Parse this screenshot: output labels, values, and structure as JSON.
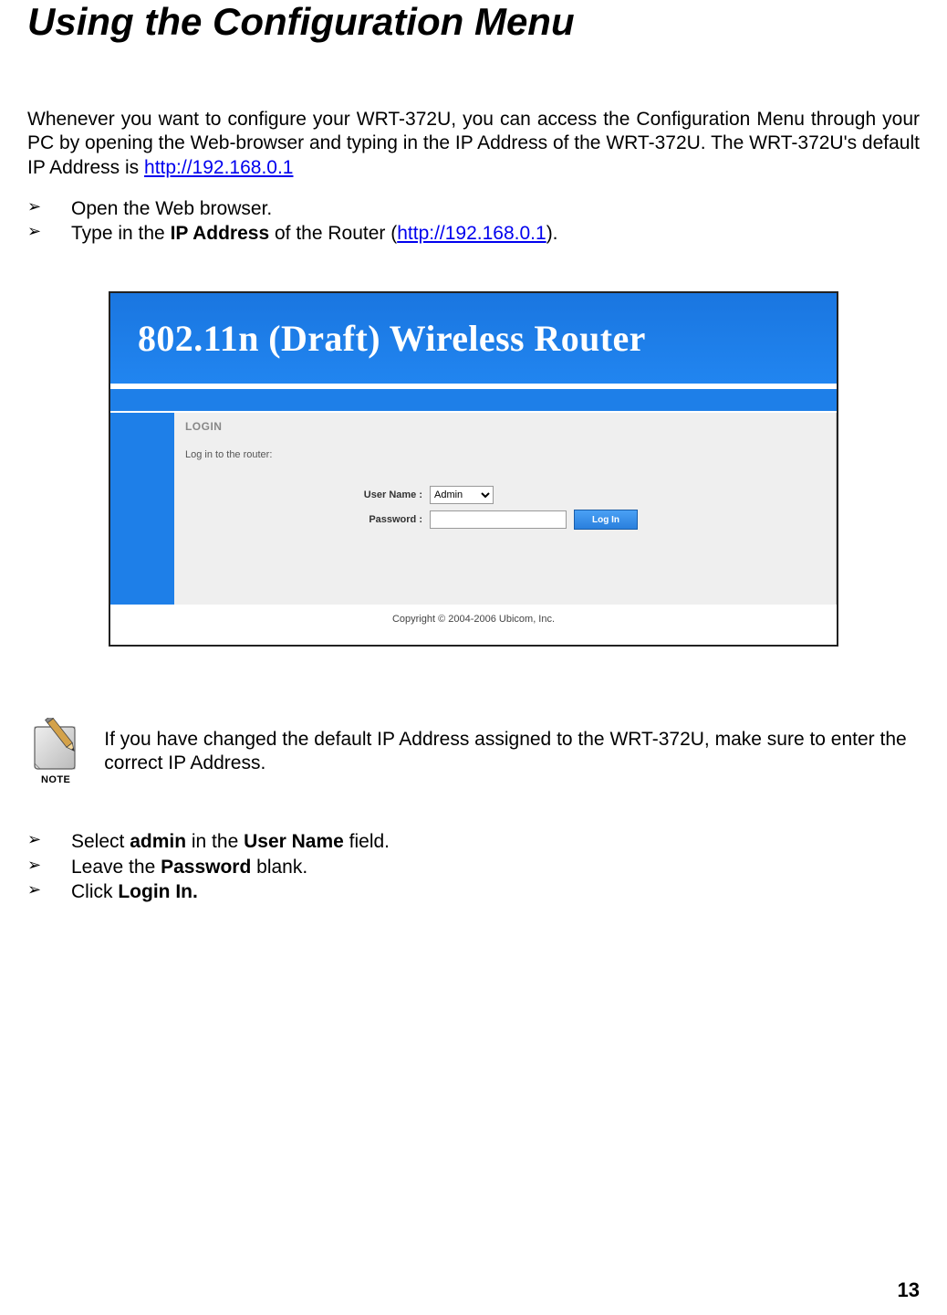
{
  "title": "Using the Configuration Menu",
  "intro": {
    "pre": "Whenever you want to configure your WRT-372U, you can access the Configuration Menu through your PC by opening the Web-browser and typing in the IP Address of the WRT-372U. The WRT-372U's default IP Address is ",
    "link": "http://192.168.0.1"
  },
  "bullets_top": {
    "b1": "Open the Web browser.",
    "b2_pre": "Type in the ",
    "b2_bold": "IP Address",
    "b2_mid": " of the Router (",
    "b2_link": "http://192.168.0.1",
    "b2_post": ")."
  },
  "screenshot": {
    "banner": "802.11n (Draft) Wireless Router",
    "login_title": "LOGIN",
    "login_sub": "Log in to the router:",
    "labels": {
      "user": "User Name :",
      "pass": "Password :"
    },
    "user_value": "Admin",
    "login_btn": "Log In",
    "copyright": "Copyright © 2004-2006 Ubicom, Inc."
  },
  "note": {
    "label": "NOTE",
    "text": "If you have changed the default IP Address assigned to the WRT-372U, make sure to enter the correct IP Address."
  },
  "bullets_bottom": {
    "b1_pre": "Select ",
    "b1_bold1": "admin",
    "b1_mid": " in the ",
    "b1_bold2": "User Name",
    "b1_post": " field.",
    "b2_pre": "Leave the ",
    "b2_bold": "Password",
    "b2_post": " blank.",
    "b3_pre": "Click ",
    "b3_bold": "Login In."
  },
  "page_number": "13"
}
